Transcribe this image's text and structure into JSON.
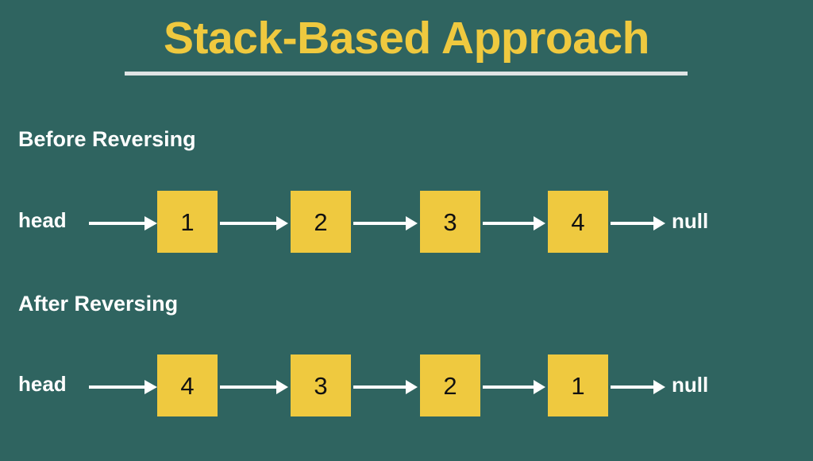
{
  "slide": {
    "background_color": "#2f6460",
    "accent_color": "#efc93f",
    "text_color": "#ffffff",
    "node_text_color": "#111111",
    "rule_color": "#dfe4e4"
  },
  "title": "Stack-Based Approach",
  "sections": [
    {
      "heading": "Before Reversing",
      "head_label": "head",
      "nodes": [
        "1",
        "2",
        "3",
        "4"
      ],
      "terminator": "null"
    },
    {
      "heading": "After Reversing",
      "head_label": "head",
      "nodes": [
        "4",
        "3",
        "2",
        "1"
      ],
      "terminator": "null"
    }
  ]
}
